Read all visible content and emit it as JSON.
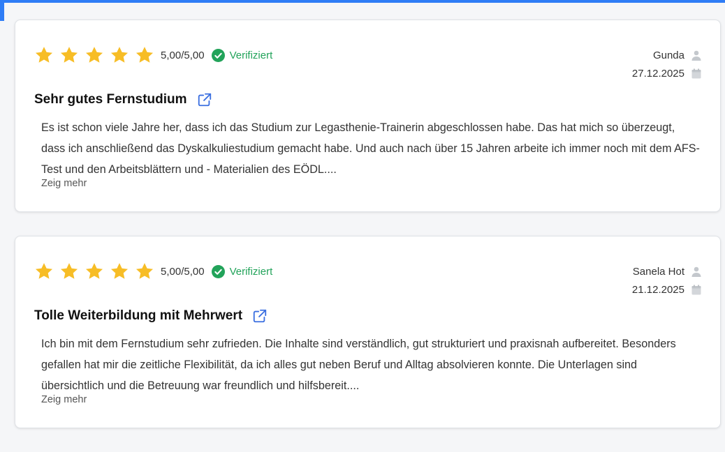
{
  "colors": {
    "accent": "#2f7df6",
    "star": "#f7bd26",
    "verified": "#22a35a",
    "link_icon": "#3b6fe0"
  },
  "reviews": [
    {
      "stars": 5,
      "score": "5,00/5,00",
      "verified_label": "Verifiziert",
      "author": "Gunda",
      "date": "27.12.2025",
      "title": "Sehr gutes Fernstudium",
      "text": "Es ist schon viele Jahre her, dass ich das Studium zur Legasthenie-Trainerin abgeschlossen habe. Das hat mich so überzeugt, dass ich anschließend das Dyskalkuliestudium gemacht habe. Und auch nach über 15 Jahren arbeite ich immer noch mit dem AFS-Test und den Arbeitsblättern und - Materialien des EÖDL....",
      "more_label": "Zeig mehr"
    },
    {
      "stars": 5,
      "score": "5,00/5,00",
      "verified_label": "Verifiziert",
      "author": "Sanela Hot",
      "date": "21.12.2025",
      "title": "Tolle Weiterbildung mit Mehrwert",
      "text": "Ich bin mit dem Fernstudium sehr zufrieden. Die Inhalte sind verständlich, gut strukturiert und praxisnah aufbereitet. Besonders gefallen hat mir die zeitliche Flexibilität, da ich alles gut neben Beruf und Alltag absolvieren konnte. Die Unterlagen sind übersichtlich und die Betreuung war freundlich und hilfsbereit....",
      "more_label": "Zeig mehr"
    }
  ],
  "icons": {
    "star": "star-icon",
    "verified": "check-circle-icon",
    "user": "user-icon",
    "calendar": "calendar-icon",
    "external_link": "external-link-icon"
  }
}
